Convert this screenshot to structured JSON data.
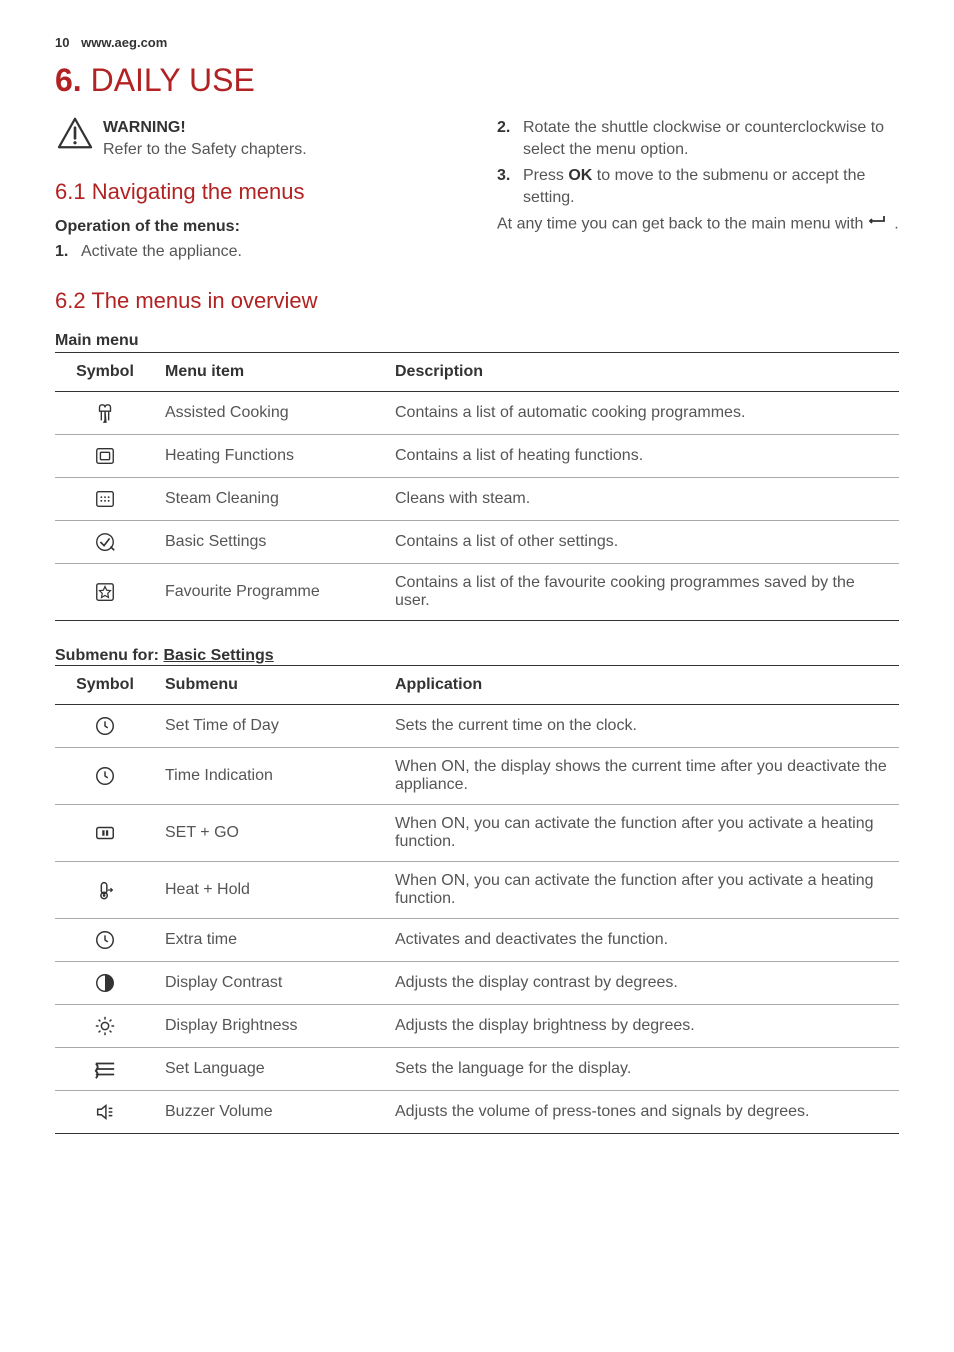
{
  "header": {
    "page_number": "10",
    "site": "www.aeg.com"
  },
  "section": {
    "number": "6.",
    "title": "DAILY USE"
  },
  "warning": {
    "title": "WARNING!",
    "text": "Refer to the Safety chapters."
  },
  "sub_61": {
    "number": "6.1",
    "title": "Navigating the menus",
    "operation_label": "Operation of the menus:",
    "steps": {
      "1": {
        "num": "1.",
        "text": "Activate the appliance."
      },
      "2": {
        "num": "2.",
        "text": "Rotate the shuttle clockwise or counterclockwise to select the menu option."
      },
      "3": {
        "num": "3.",
        "pre": "Press ",
        "ok": "OK",
        "post": " to move to the submenu or accept the setting."
      }
    },
    "back_text_pre": "At any time you can get back to the main menu with ",
    "back_text_post": " ."
  },
  "sub_62": {
    "number": "6.2",
    "title": "The menus in overview"
  },
  "main_menu": {
    "heading": "Main menu",
    "col_symbol": "Symbol",
    "col_item": "Menu item",
    "col_desc": "Description",
    "rows": {
      "0": {
        "item": "Assisted Cooking",
        "desc": "Contains a list of automatic cooking programmes."
      },
      "1": {
        "item": "Heating Functions",
        "desc": "Contains a list of heating functions."
      },
      "2": {
        "item": "Steam Cleaning",
        "desc": "Cleans with steam."
      },
      "3": {
        "item": "Basic Settings",
        "desc": "Contains a list of other settings."
      },
      "4": {
        "item": "Favourite Programme",
        "desc": "Contains a list of the favourite cooking programmes saved by the user."
      }
    }
  },
  "submenu": {
    "label_pre": "Submenu for: ",
    "label_target": "Basic Settings",
    "col_symbol": "Symbol",
    "col_item": "Submenu",
    "col_app": "Application",
    "rows": {
      "0": {
        "item": "Set Time of Day",
        "app": "Sets the current time on the clock."
      },
      "1": {
        "item": "Time Indication",
        "app": "When ON, the display shows the current time after you deactivate the appliance."
      },
      "2": {
        "item": "SET + GO",
        "app": "When ON, you can activate the function after you activate a heating function."
      },
      "3": {
        "item": "Heat + Hold",
        "app": "When ON, you can activate the function after you activate a heating function."
      },
      "4": {
        "item": "Extra time",
        "app": "Activates and deactivates the function."
      },
      "5": {
        "item": "Display Contrast",
        "app": "Adjusts the display contrast by degrees."
      },
      "6": {
        "item": "Display Brightness",
        "app": "Adjusts the display brightness by degrees."
      },
      "7": {
        "item": "Set Language",
        "app": "Sets the language for the display."
      },
      "8": {
        "item": "Buzzer Volume",
        "app": "Adjusts the volume of press-tones and signals by degrees."
      }
    }
  }
}
